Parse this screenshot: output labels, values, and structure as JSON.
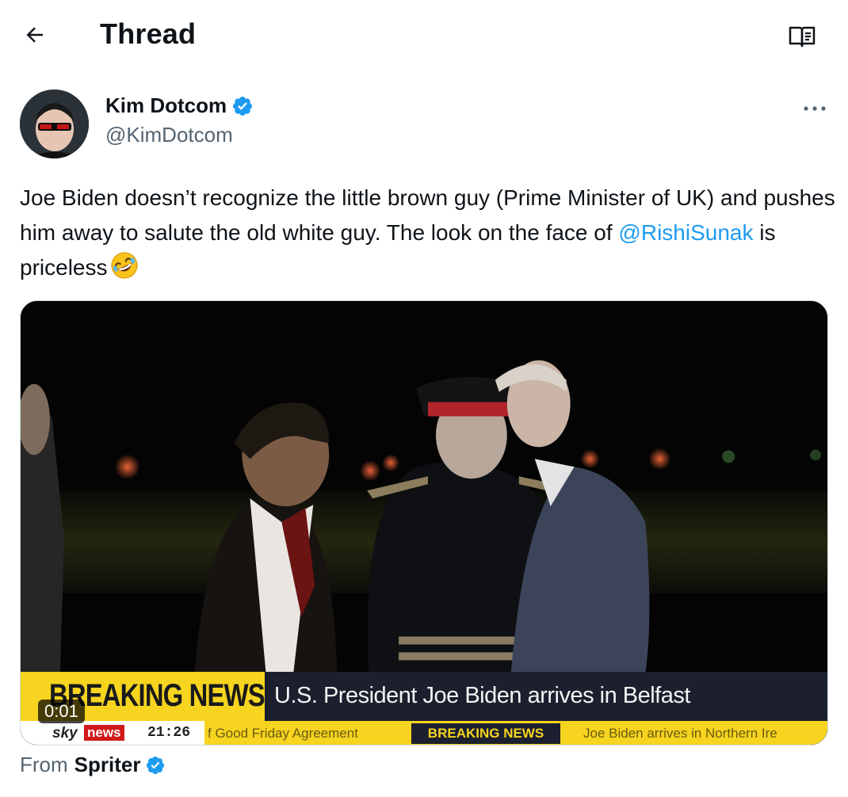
{
  "header": {
    "title": "Thread"
  },
  "tweet": {
    "author_name": "Kim Dotcom",
    "author_handle": "@KimDotcom",
    "text_part1": "Joe Biden doesn’t recognize the little brown guy (Prime Minister of UK) and pushes him away to salute the old white guy. The look on the face of ",
    "mention": "@RishiSunak",
    "text_part2": " is priceless"
  },
  "media": {
    "timestamp": "0:01",
    "breaking_label": "BREAKING NEWS",
    "headline": "U.S. President Joe Biden arrives in Belfast",
    "ticker_brand": "sky",
    "ticker_news": "news",
    "ticker_time": "21:26",
    "ticker_text1": "f Good Friday Agreement",
    "ticker_breaking": "BREAKING NEWS",
    "ticker_text2": "Joe Biden arrives in Northern Ire"
  },
  "source": {
    "prefix": "From",
    "name": "Spriter"
  },
  "colors": {
    "accent": "#1d9bf0",
    "text": "#0f1419",
    "secondary": "#536471",
    "breaking_yellow": "#f6d41f"
  },
  "icons": [
    "back-arrow-icon",
    "reader-mode-icon",
    "verified-badge-icon",
    "more-icon",
    "rolling-laughing-emoji"
  ]
}
